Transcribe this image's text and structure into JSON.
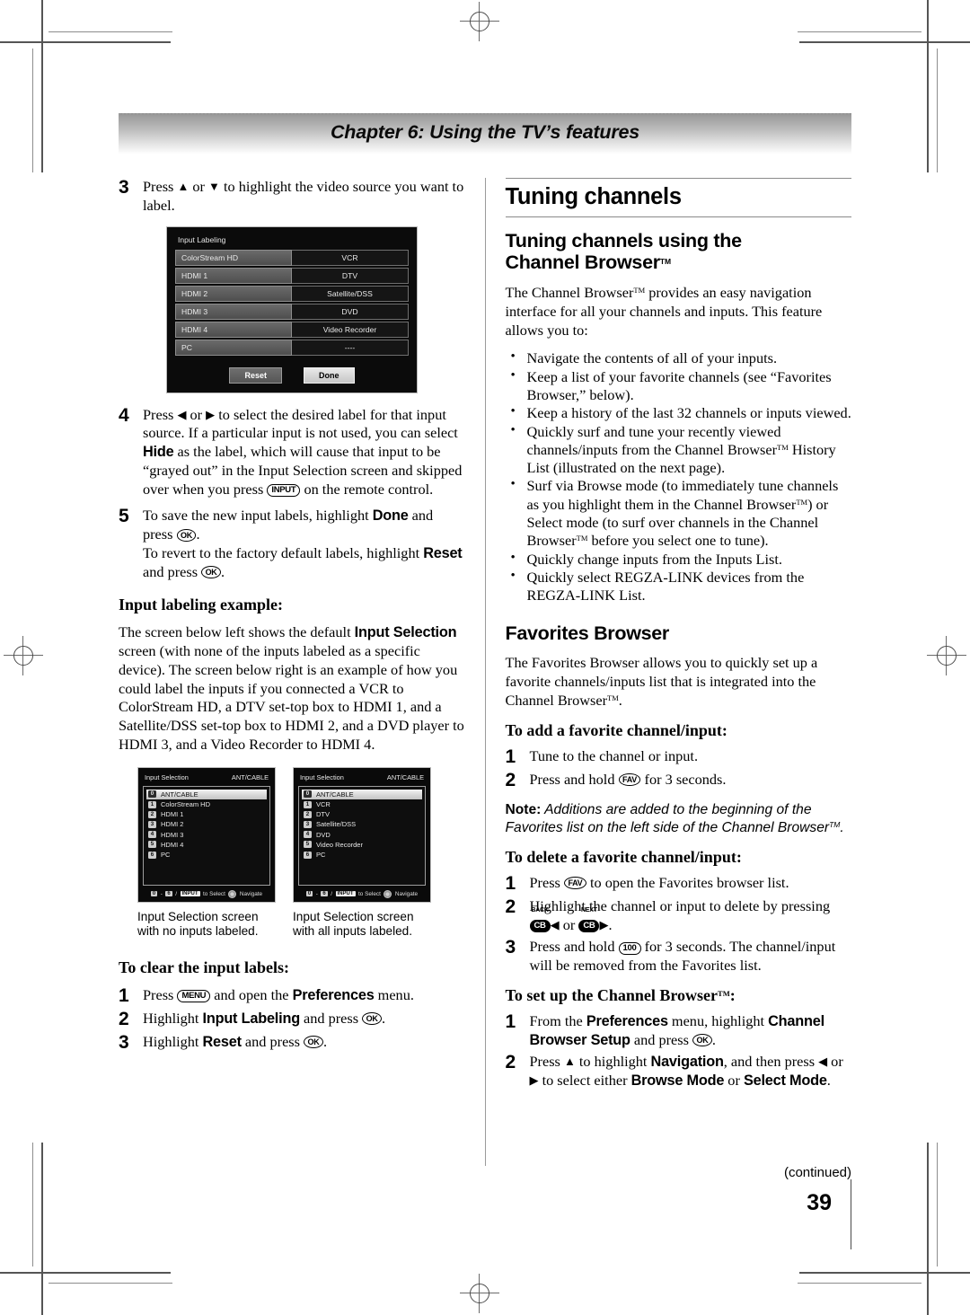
{
  "header": {
    "chapter_title": "Chapter 6: Using the TV’s features"
  },
  "page_number": "39",
  "continued_label": "(continued)",
  "left_column": {
    "step3": {
      "num": "3",
      "text_a": "Press ",
      "arrow_up": "▲",
      "text_b": " or ",
      "arrow_down": "▼",
      "text_c": " to highlight the video source you want to label."
    },
    "input_labeling_osd": {
      "title": "Input Labeling",
      "rows": [
        {
          "label": "ColorStream HD",
          "value": "VCR"
        },
        {
          "label": "HDMI 1",
          "value": "DTV"
        },
        {
          "label": "HDMI 2",
          "value": "Satellite/DSS"
        },
        {
          "label": "HDMI 3",
          "value": "DVD"
        },
        {
          "label": "HDMI 4",
          "value": "Video Recorder"
        },
        {
          "label": "PC",
          "value": "----"
        }
      ],
      "reset_button": "Reset",
      "done_button": "Done"
    },
    "step4": {
      "num": "4",
      "t1": "Press ",
      "a1": "◀",
      "t2": " or ",
      "a2": "▶",
      "t3": " to select the desired label for that input source. If a particular input is not used, you can select ",
      "hide": "Hide",
      "t4": " as the label, which will cause that input to be “grayed out” in the Input Selection screen and skipped over when you press ",
      "input_key": "INPUT",
      "t5": " on the remote control."
    },
    "step5": {
      "num": "5",
      "t1": "To save the new input labels, highlight ",
      "done": "Done",
      "t2": " and press ",
      "ok_key": "OK",
      "t3": ".",
      "t4": "To revert to the factory default labels, highlight ",
      "reset": "Reset",
      "t5": " and press ",
      "t6": "."
    },
    "example_heading": "Input labeling example:",
    "example_para": {
      "t1": "The screen below left shows the default ",
      "bold1": "Input Selection",
      "t2": " screen (with none of the inputs labeled as a specific device). The screen below right is an example of how you could label the inputs if you connected a VCR to ColorStream HD, a DTV set-top box to HDMI 1, and a Satellite/DSS set-top box to HDMI 2, and a DVD player to HDMI 3, and a Video Recorder to HDMI 4."
    },
    "input_selection_left": {
      "title": "Input Selection",
      "source": "ANT/CABLE",
      "items": [
        {
          "n": "0",
          "label": "ANT/CABLE",
          "selected": true
        },
        {
          "n": "1",
          "label": "ColorStream HD",
          "selected": false
        },
        {
          "n": "2",
          "label": "HDMI 1",
          "selected": false
        },
        {
          "n": "3",
          "label": "HDMI 2",
          "selected": false
        },
        {
          "n": "4",
          "label": "HDMI 3",
          "selected": false
        },
        {
          "n": "5",
          "label": "HDMI 4",
          "selected": false
        },
        {
          "n": "6",
          "label": "PC",
          "selected": false
        }
      ],
      "footer_range_a": "0",
      "footer_dash": "-",
      "footer_range_b": "6",
      "footer_slash": "/",
      "footer_input": "INPUT",
      "footer_select": "to Select",
      "footer_navigate": "Navigate"
    },
    "input_selection_right": {
      "title": "Input Selection",
      "source": "ANT/CABLE",
      "items": [
        {
          "n": "0",
          "label": "ANT/CABLE",
          "selected": true
        },
        {
          "n": "1",
          "label": "VCR",
          "selected": false
        },
        {
          "n": "2",
          "label": "DTV",
          "selected": false
        },
        {
          "n": "3",
          "label": "Satellite/DSS",
          "selected": false
        },
        {
          "n": "4",
          "label": "DVD",
          "selected": false
        },
        {
          "n": "5",
          "label": "Video Recorder",
          "selected": false
        },
        {
          "n": "6",
          "label": "PC",
          "selected": false
        }
      ],
      "footer_range_a": "0",
      "footer_dash": "-",
      "footer_range_b": "6",
      "footer_slash": "/",
      "footer_input": "INPUT",
      "footer_select": "to Select",
      "footer_navigate": "Navigate"
    },
    "caption_left": "Input Selection screen with no inputs labeled.",
    "caption_right": "Input Selection screen with all inputs labeled.",
    "clear_heading": "To clear the input labels:",
    "clear_steps": [
      {
        "num": "1",
        "t1": "Press ",
        "key": "MENU",
        "t2": " and open the ",
        "bold": "Preferences",
        "t3": " menu."
      },
      {
        "num": "2",
        "t1": "Highlight ",
        "bold": "Input Labeling",
        "t2": " and press ",
        "key": "OK",
        "t3": "."
      },
      {
        "num": "3",
        "t1": "Highlight ",
        "bold": "Reset",
        "t2": " and press ",
        "key": "OK",
        "t3": "."
      }
    ]
  },
  "right_column": {
    "major_heading": "Tuning channels",
    "sub_heading_line1": "Tuning channels using the",
    "sub_heading_line2": "Channel Browser",
    "tm": "TM",
    "intro_para": {
      "t1": "The Channel Browser",
      "t2": " provides an easy navigation interface for all your channels and inputs. This feature allows you to:"
    },
    "bullets": [
      {
        "parts": [
          {
            "t": "Navigate the contents of all of your inputs."
          }
        ]
      },
      {
        "parts": [
          {
            "t": "Keep a list of your favorite channels (see “Favorites Browser,” below)."
          }
        ]
      },
      {
        "parts": [
          {
            "t": "Keep a history of the last 32 channels or inputs viewed."
          }
        ]
      },
      {
        "parts": [
          {
            "t": "Quickly surf and tune your recently viewed channels/inputs from the Channel Browser"
          },
          {
            "tm": true
          },
          {
            "t": " History List (illustrated on the next page)."
          }
        ]
      },
      {
        "parts": [
          {
            "t": "Surf via Browse mode (to immediately tune channels as you highlight them in the Channel Browser"
          },
          {
            "tm": true
          },
          {
            "t": ") or Select mode (to surf over channels in the Channel Browser"
          },
          {
            "tm": true
          },
          {
            "t": " before you select one to tune)."
          }
        ]
      },
      {
        "parts": [
          {
            "t": "Quickly change inputs from the Inputs List."
          }
        ]
      },
      {
        "parts": [
          {
            "t": "Quickly select REGZA-LINK devices from the REGZA-LINK List."
          }
        ]
      }
    ],
    "favorites_heading": "Favorites Browser",
    "favorites_para": {
      "t1": "The Favorites Browser allows you to quickly set up a favorite channels/inputs list that is integrated into the Channel Browser",
      "t2": "."
    },
    "add_heading": "To add a favorite channel/input:",
    "add_steps": [
      {
        "num": "1",
        "t1": "Tune to the channel or input."
      },
      {
        "num": "2",
        "t1": "Press and hold ",
        "key": "FAV",
        "t2": " for 3 seconds."
      }
    ],
    "note": {
      "label": "Note:",
      "t1": " Additions are added to the beginning of the Favorites list on the left side of the Channel Browser",
      "t2": "."
    },
    "delete_heading": "To delete a favorite channel/input:",
    "delete_steps": [
      {
        "num": "1",
        "t1": "Press ",
        "key": "FAV",
        "t2": " to open the Favorites browser list."
      },
      {
        "num": "2",
        "t1": "Highlight the channel or input to delete by pressing ",
        "key_back_label": "BACK",
        "key_back": "CB",
        "arrow1": "◀",
        "t2": " or ",
        "key_next_label": "NEXT",
        "key_next": "CB",
        "arrow2": "▶",
        "t3": "."
      },
      {
        "num": "3",
        "t1": "Press and hold ",
        "key": "100",
        "t2": " for 3 seconds. The channel/input will be removed from the Favorites list."
      }
    ],
    "setup_heading_a": "To set up the Channel Browser",
    "setup_heading_b": ":",
    "setup_steps": [
      {
        "num": "1",
        "t1": "From the ",
        "b1": "Preferences",
        "t2": " menu, highlight ",
        "b2": "Channel Browser Setup",
        "t3": " and press ",
        "key": "OK",
        "t4": "."
      },
      {
        "num": "2",
        "t1": "Press ",
        "a1": "▲",
        "t2": " to highlight ",
        "b1": "Navigation",
        "t3": ", and then press ",
        "a2": "◀",
        "t4": " or ",
        "a3": "▶",
        "t5": " to select either ",
        "b2": "Browse Mode",
        "t6": " or ",
        "b3": "Select Mode",
        "t7": "."
      }
    ]
  }
}
